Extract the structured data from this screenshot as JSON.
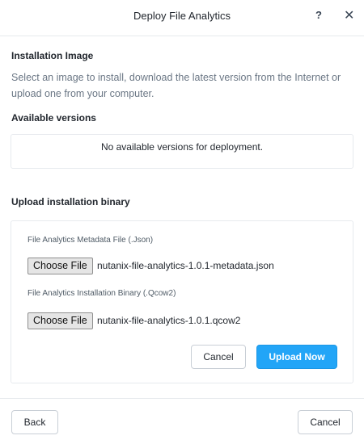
{
  "dialog": {
    "title": "Deploy File Analytics",
    "help_label": "?",
    "close_label": "✕"
  },
  "installation_image": {
    "title": "Installation Image",
    "description": "Select an image to install, download the latest version from the Internet or upload one from your computer."
  },
  "available_versions": {
    "title": "Available versions",
    "empty_message": "No available versions for deployment."
  },
  "upload": {
    "title": "Upload installation binary",
    "metadata_label": "File Analytics Metadata File (.Json)",
    "metadata_button": "Choose File",
    "metadata_file": "nutanix-file-analytics-1.0.1-metadata.json",
    "binary_label": "File Analytics Installation Binary (.Qcow2)",
    "binary_button": "Choose File",
    "binary_file": "nutanix-file-analytics-1.0.1.qcow2",
    "cancel_label": "Cancel",
    "upload_label": "Upload Now"
  },
  "footer": {
    "back_label": "Back",
    "cancel_label": "Cancel"
  },
  "colors": {
    "primary": "#22a5f7",
    "description_text": "#6b7785",
    "border": "#e7eaee"
  }
}
